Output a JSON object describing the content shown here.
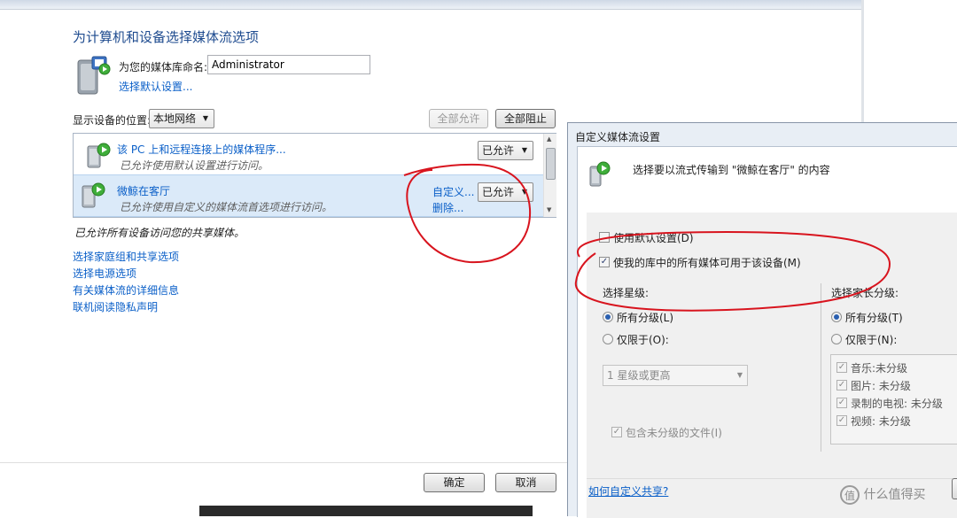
{
  "main": {
    "title": "为计算机和设备选择媒体流选项",
    "library_name_label": "为您的媒体库命名:",
    "library_name_value": "Administrator",
    "choose_default_link": "选择默认设置...",
    "show_devices_label": "显示设备的位置:",
    "location_value": "本地网络",
    "allow_all_button": "全部允许",
    "block_all_button": "全部阻止",
    "devices": [
      {
        "name": "该 PC 上和远程连接上的媒体程序...",
        "status": "已允许使用默认设置进行访问。",
        "permission": "已允许"
      },
      {
        "name": "微鲸在客厅",
        "status": "已允许使用自定义的媒体流首选项进行访问。",
        "permission": "已允许",
        "customize_link": "自定义...",
        "remove_link": "删除..."
      }
    ],
    "summary_text": "已允许所有设备访问您的共享媒体。",
    "links": [
      "选择家庭组和共享选项",
      "选择电源选项",
      "有关媒体流的详细信息",
      "联机阅读隐私声明"
    ],
    "ok_button": "确定",
    "cancel_button": "取消"
  },
  "dialog": {
    "title": "自定义媒体流设置",
    "header_text": "选择要以流式传输到 \"微鲸在客厅\" 的内容",
    "use_default_label": "使用默认设置(D)",
    "use_default_checked": false,
    "make_all_available_label": "使我的库中的所有媒体可用于该设备(M)",
    "make_all_available_checked": true,
    "star_rating": {
      "heading": "选择星级:",
      "all_label": "所有分级(L)",
      "only_label": "仅限于(O):",
      "selected": "all",
      "dropdown_value": "1 星级或更高",
      "include_unrated_label": "包含未分级的文件(I)",
      "include_unrated_checked": true
    },
    "parental_rating": {
      "heading": "选择家长分级:",
      "all_label": "所有分级(T)",
      "only_label": "仅限于(N):",
      "selected": "all",
      "items": [
        {
          "label": "音乐:未分级",
          "checked": true
        },
        {
          "label": "图片: 未分级",
          "checked": true
        },
        {
          "label": "录制的电视: 未分级",
          "checked": true
        },
        {
          "label": "视频: 未分级",
          "checked": true
        }
      ]
    },
    "help_link": "如何自定义共享?"
  },
  "watermark": "什么值得买",
  "colors": {
    "link": "#0a5fc8",
    "title_blue": "#1e4b8f",
    "selected_row": "#dbeaf9",
    "annotation_red": "#d8141e"
  }
}
